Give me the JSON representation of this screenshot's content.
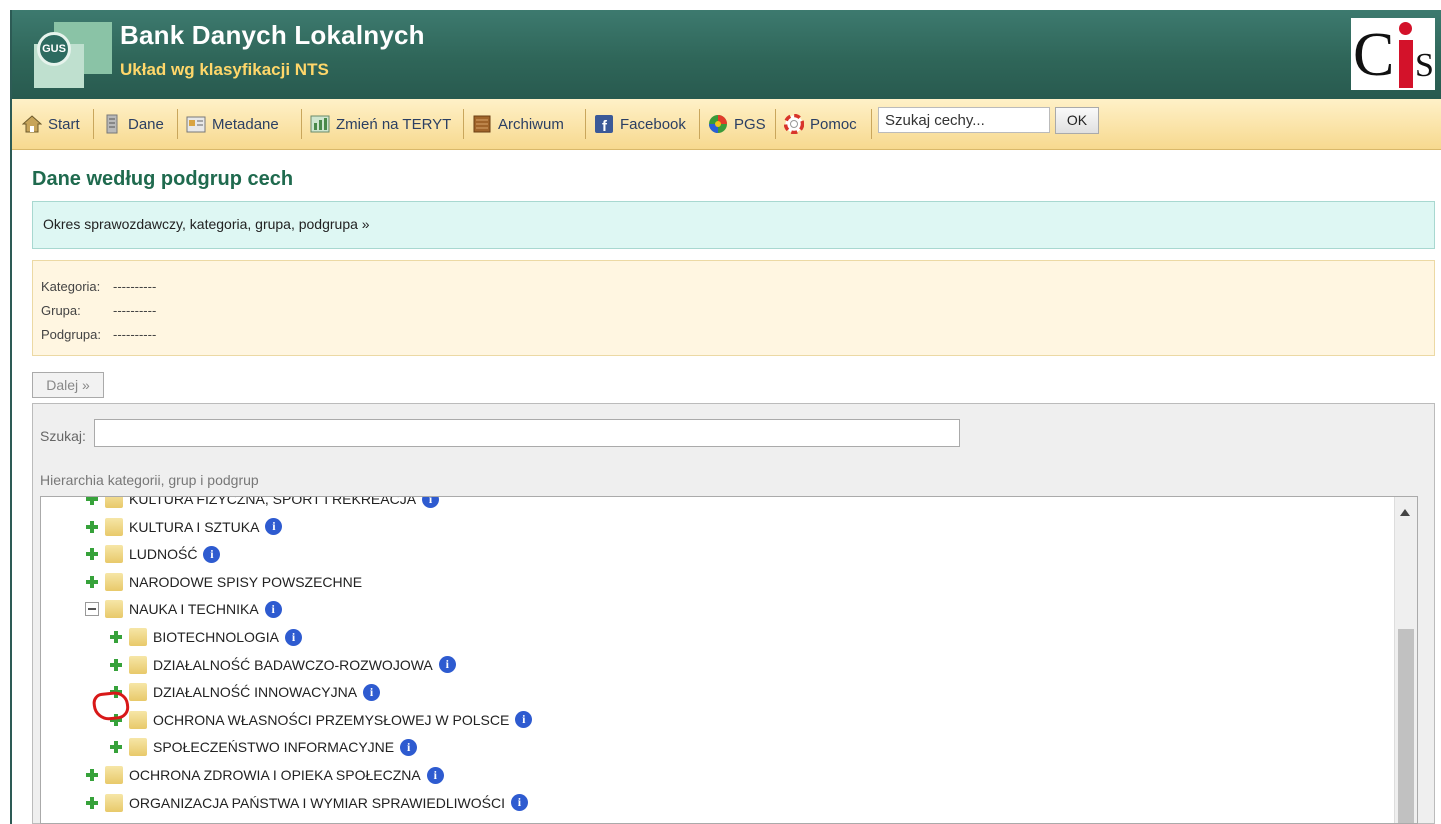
{
  "header": {
    "logo_text": "GUS",
    "title": "Bank Danych Lokalnych",
    "subtitle": "Układ wg klasyfikacji NTS",
    "brand_logo_text": "CIS"
  },
  "toolbar": {
    "items": [
      {
        "label": "Start",
        "icon": "home-icon"
      },
      {
        "label": "Dane",
        "icon": "database-icon"
      },
      {
        "label": "Metadane",
        "icon": "metadata-icon"
      },
      {
        "label": "Zmień na TERYT",
        "icon": "switch-icon"
      },
      {
        "label": "Archiwum",
        "icon": "archive-icon"
      },
      {
        "label": "Facebook",
        "icon": "facebook-icon"
      },
      {
        "label": "PGS",
        "icon": "pgs-icon"
      },
      {
        "label": "Pomoc",
        "icon": "help-lifebuoy-icon"
      }
    ],
    "search_value": "Szukaj cechy...",
    "ok_label": "OK"
  },
  "page": {
    "title": "Dane według podgrup cech",
    "breadcrumb": "Okres sprawozdawczy, kategoria, grupa, podgrupa »",
    "selection": {
      "kategoria_label": "Kategoria:",
      "kategoria_value": "----------",
      "grupa_label": "Grupa:",
      "grupa_value": "----------",
      "podgrupa_label": "Podgrupa:",
      "podgrupa_value": "----------"
    },
    "next_button": "Dalej »",
    "search_label": "Szukaj:",
    "search_value": "",
    "hierarchy_label": "Hierarchia kategorii, grup i podgrup"
  },
  "tree": {
    "nodes": [
      {
        "label": "KULTURA FIZYCZNA, SPORT I REKREACJA",
        "level": 0,
        "expander": "plus",
        "info": true
      },
      {
        "label": "KULTURA I SZTUKA",
        "level": 0,
        "expander": "plus",
        "info": true
      },
      {
        "label": "LUDNOŚĆ",
        "level": 0,
        "expander": "plus",
        "info": true
      },
      {
        "label": "NARODOWE SPISY POWSZECHNE",
        "level": 0,
        "expander": "plus",
        "info": false
      },
      {
        "label": "NAUKA I TECHNIKA",
        "level": 0,
        "expander": "minus",
        "info": true
      },
      {
        "label": "BIOTECHNOLOGIA",
        "level": 1,
        "expander": "plus",
        "info": true
      },
      {
        "label": "DZIAŁALNOŚĆ BADAWCZO-ROZWOJOWA",
        "level": 1,
        "expander": "plus",
        "info": true
      },
      {
        "label": "DZIAŁALNOŚĆ INNOWACYJNA",
        "level": 1,
        "expander": "plus",
        "info": true
      },
      {
        "label": "OCHRONA WŁASNOŚCI PRZEMYSŁOWEJ W POLSCE",
        "level": 1,
        "expander": "plus",
        "info": true
      },
      {
        "label": "SPOŁECZEŃSTWO INFORMACYJNE",
        "level": 1,
        "expander": "plus",
        "info": true
      },
      {
        "label": "OCHRONA ZDROWIA I OPIEKA SPOŁECZNA",
        "level": 0,
        "expander": "plus",
        "info": true
      },
      {
        "label": "ORGANIZACJA PAŃSTWA I WYMIAR SPRAWIEDLIWOŚCI",
        "level": 0,
        "expander": "plus",
        "info": true
      }
    ]
  },
  "colors": {
    "header_green": "#2f6659",
    "toolbar_gold": "#f7d98f",
    "title_green": "#1f6a4e",
    "info_blue": "#2e5bd0",
    "plus_green": "#36a23a",
    "annotation_red": "#d81818"
  }
}
